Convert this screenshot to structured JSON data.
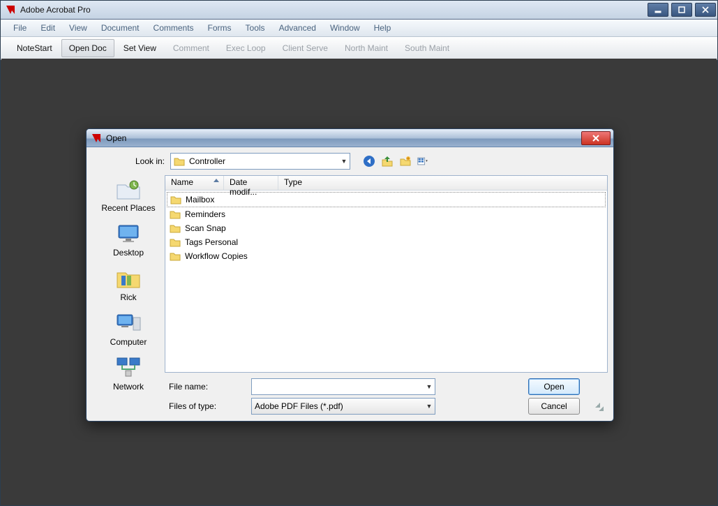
{
  "app": {
    "title": "Adobe Acrobat Pro"
  },
  "menu": {
    "items": [
      "File",
      "Edit",
      "View",
      "Document",
      "Comments",
      "Forms",
      "Tools",
      "Advanced",
      "Window",
      "Help"
    ]
  },
  "toolbar": {
    "items": [
      {
        "label": "NoteStart",
        "enabled": true,
        "pressed": false
      },
      {
        "label": "Open Doc",
        "enabled": true,
        "pressed": true
      },
      {
        "label": "Set View",
        "enabled": true,
        "pressed": false
      },
      {
        "label": "Comment",
        "enabled": false,
        "pressed": false
      },
      {
        "label": "Exec Loop",
        "enabled": false,
        "pressed": false
      },
      {
        "label": "Client Serve",
        "enabled": false,
        "pressed": false
      },
      {
        "label": "North Maint",
        "enabled": false,
        "pressed": false
      },
      {
        "label": "South Maint",
        "enabled": false,
        "pressed": false
      }
    ]
  },
  "dialog": {
    "title": "Open",
    "look_in_label": "Look in:",
    "look_in_value": "Controller",
    "nav_icons": [
      "back-icon",
      "up-one-level-icon",
      "new-folder-icon",
      "views-icon"
    ],
    "places": [
      {
        "label": "Recent Places",
        "icon": "recent-places-icon"
      },
      {
        "label": "Desktop",
        "icon": "desktop-icon"
      },
      {
        "label": "Rick",
        "icon": "user-folder-icon"
      },
      {
        "label": "Computer",
        "icon": "computer-icon"
      },
      {
        "label": "Network",
        "icon": "network-icon"
      }
    ],
    "columns": [
      "Name",
      "Date modif...",
      "Type"
    ],
    "sort_column_index": 0,
    "files": [
      {
        "name": "Mailbox",
        "kind": "folder",
        "selected": true
      },
      {
        "name": "Reminders",
        "kind": "folder",
        "selected": false
      },
      {
        "name": "Scan Snap",
        "kind": "folder",
        "selected": false
      },
      {
        "name": "Tags Personal",
        "kind": "folder",
        "selected": false
      },
      {
        "name": "Workflow Copies",
        "kind": "folder",
        "selected": false
      }
    ],
    "file_name_label": "File name:",
    "file_name_value": "",
    "file_type_label": "Files of type:",
    "file_type_value": "Adobe PDF Files (*.pdf)",
    "open_label": "Open",
    "cancel_label": "Cancel"
  }
}
